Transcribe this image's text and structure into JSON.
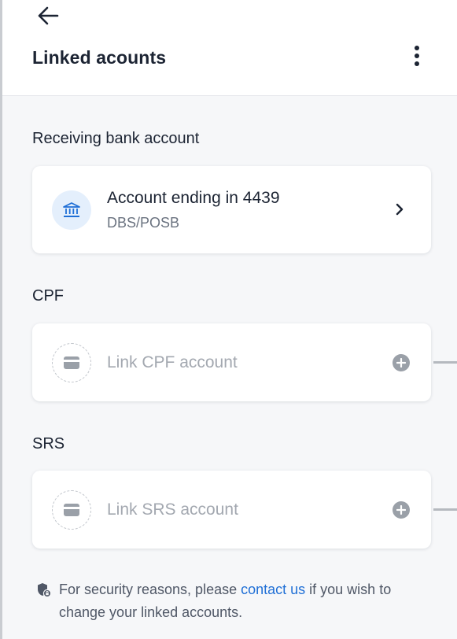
{
  "header": {
    "title": "Linked acounts",
    "back_icon": "arrow-left-icon",
    "more_icon": "more-vertical-icon"
  },
  "bank_section": {
    "title": "Receiving bank account",
    "card": {
      "title": "Account ending in 4439",
      "subtitle": "DBS/POSB",
      "icon": "bank-icon"
    }
  },
  "cpf_section": {
    "title": "CPF",
    "card": {
      "label": "Link CPF account",
      "icon": "card-icon",
      "action_icon": "plus-circle-icon"
    }
  },
  "srs_section": {
    "title": "SRS",
    "card": {
      "label": "Link SRS account",
      "icon": "card-icon",
      "action_icon": "plus-circle-icon"
    }
  },
  "notice": {
    "prefix": "For security reasons, please ",
    "link": "contact us",
    "suffix": " if you wish to change your linked accounts.",
    "icon": "shield-lock-icon"
  },
  "colors": {
    "accent": "#1f6fd6",
    "text": "#1c2433",
    "muted": "#a3a8b0",
    "background": "#f6f7f9"
  }
}
